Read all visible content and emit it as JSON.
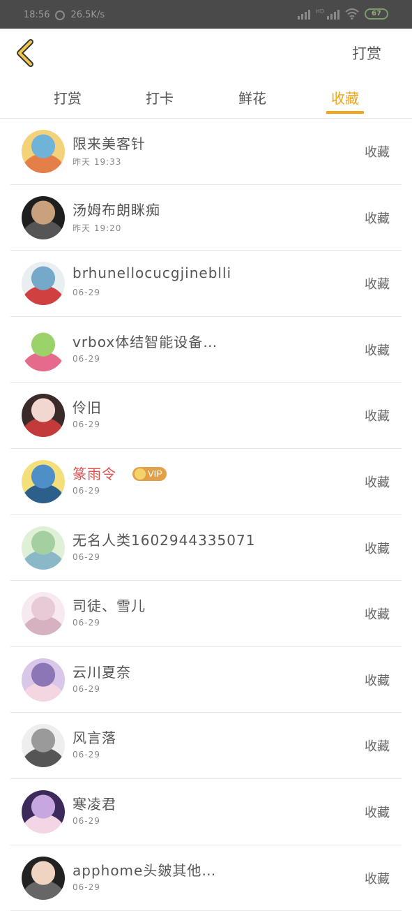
{
  "status_bar": {
    "time": "18:56",
    "speed": "26.5K/s",
    "battery": "67",
    "hd": "HD"
  },
  "header": {
    "action_label": "打赏",
    "accent": "#f2a51a"
  },
  "tabs": [
    {
      "label": "打赏",
      "active": false
    },
    {
      "label": "打卡",
      "active": false
    },
    {
      "label": "鲜花",
      "active": false
    },
    {
      "label": "收藏",
      "active": true
    }
  ],
  "vip_label": "VIP",
  "list": [
    {
      "name": "限来美客针",
      "time": "昨天 19:33",
      "action": "收藏",
      "avatar_colors": [
        "#f3d27a",
        "#6fb3d9",
        "#e47f4a"
      ]
    },
    {
      "name": "汤姆布朗眯痴",
      "time": "昨天 19:20",
      "action": "收藏",
      "avatar_colors": [
        "#1f1f1f",
        "#c9a27d",
        "#555555"
      ]
    },
    {
      "name": "brhunellocucgjineblli",
      "time": "06-29",
      "action": "收藏",
      "avatar_colors": [
        "#e9eef0",
        "#74a9c9",
        "#d04040"
      ]
    },
    {
      "name": "vrbox体结智能设备…",
      "time": "06-29",
      "action": "收藏",
      "avatar_colors": [
        "#ffffff",
        "#9bd36a",
        "#e66b8a"
      ]
    },
    {
      "name": "伶旧",
      "time": "06-29",
      "action": "收藏",
      "avatar_colors": [
        "#3a2a2a",
        "#f1d7cf",
        "#c23a3a"
      ]
    },
    {
      "name": "篆雨令",
      "time": "06-29",
      "action": "收藏",
      "vip": true,
      "avatar_colors": [
        "#f4e07a",
        "#4f8fc7",
        "#2c5f8a"
      ]
    },
    {
      "name": "无名人类1602944335071",
      "time": "06-29",
      "action": "收藏",
      "avatar_colors": [
        "#dff0d6",
        "#a4cfa0",
        "#8bb8c7"
      ]
    },
    {
      "name": "司徒、雪儿",
      "time": "06-29",
      "action": "收藏",
      "avatar_colors": [
        "#f6e9ef",
        "#e8c9d6",
        "#d6b1c1"
      ]
    },
    {
      "name": "云川夏奈",
      "time": "06-29",
      "action": "收藏",
      "avatar_colors": [
        "#d9c7ea",
        "#8d76b6",
        "#f3d6e2"
      ]
    },
    {
      "name": "风言落",
      "time": "06-29",
      "action": "收藏",
      "avatar_colors": [
        "#eeeeee",
        "#9a9a9a",
        "#555555"
      ]
    },
    {
      "name": "寒凌君",
      "time": "06-29",
      "action": "收藏",
      "avatar_colors": [
        "#3b2a5a",
        "#c8a7e0",
        "#f2d6e6"
      ]
    },
    {
      "name": "apphome头皴其他…",
      "time": "06-29",
      "action": "收藏",
      "avatar_colors": [
        "#222222",
        "#f0d4c2",
        "#666666"
      ]
    }
  ]
}
